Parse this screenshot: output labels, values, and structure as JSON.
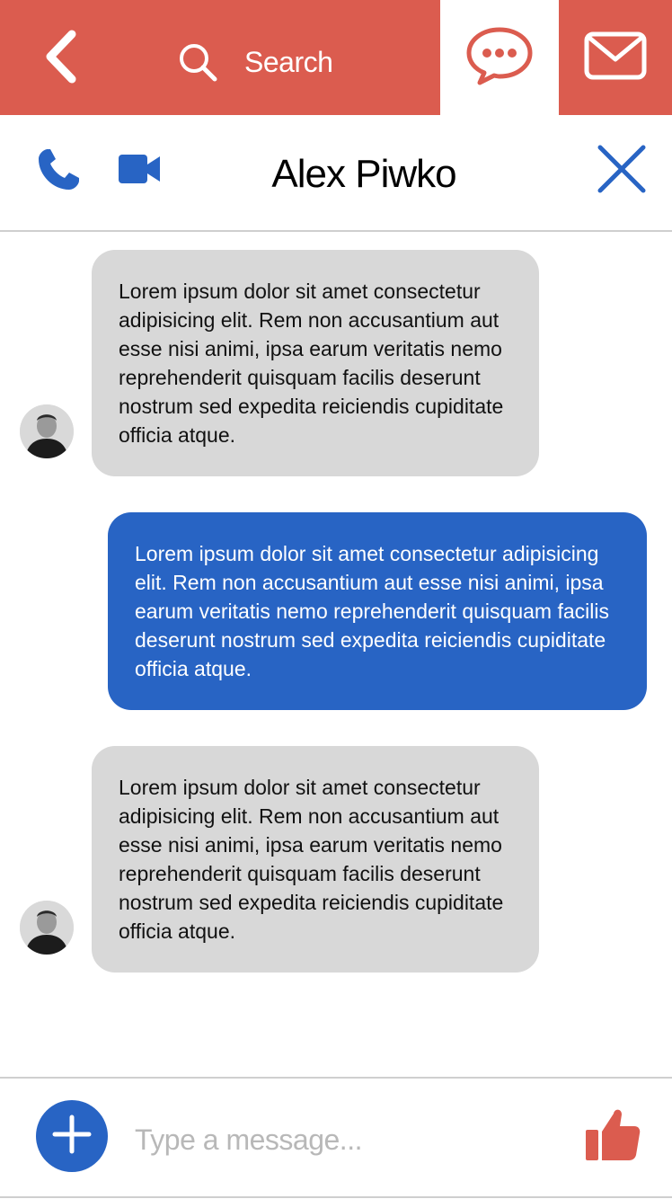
{
  "topbar": {
    "search_label": "Search",
    "icons": {
      "back": "chevron-left-icon",
      "search": "search-icon",
      "chat": "speech-bubble-icon",
      "mail": "envelope-icon"
    },
    "active_tab": "chat"
  },
  "chat_header": {
    "contact_name": "Alex Piwko",
    "icons": {
      "call": "phone-icon",
      "video": "video-camera-icon",
      "close": "close-icon"
    }
  },
  "messages": [
    {
      "direction": "incoming",
      "text": "Lorem ipsum dolor sit amet consectetur adipisicing elit. Rem non accusantium aut esse nisi animi, ipsa earum veritatis nemo reprehenderit quisquam facilis deserunt nostrum sed expedita reiciendis cupiditate officia atque."
    },
    {
      "direction": "outgoing",
      "text": "Lorem ipsum dolor sit amet consectetur adipisicing elit. Rem non accusantium aut esse nisi animi, ipsa earum veritatis nemo reprehenderit quisquam facilis deserunt nostrum sed expedita reiciendis cupiditate officia atque."
    },
    {
      "direction": "incoming",
      "text": "Lorem ipsum dolor sit amet consectetur adipisicing elit. Rem non accusantium aut esse nisi animi, ipsa earum veritatis nemo reprehenderit quisquam facilis deserunt nostrum sed expedita reiciendis cupiditate officia atque."
    }
  ],
  "composer": {
    "placeholder": "Type a message...",
    "value": "",
    "icons": {
      "add": "plus-icon",
      "like": "thumbs-up-icon"
    }
  },
  "colors": {
    "brand_red": "#db5c4f",
    "accent_blue": "#2864c4",
    "incoming_bubble": "#d8d8d8",
    "divider": "#cfcfcf"
  }
}
